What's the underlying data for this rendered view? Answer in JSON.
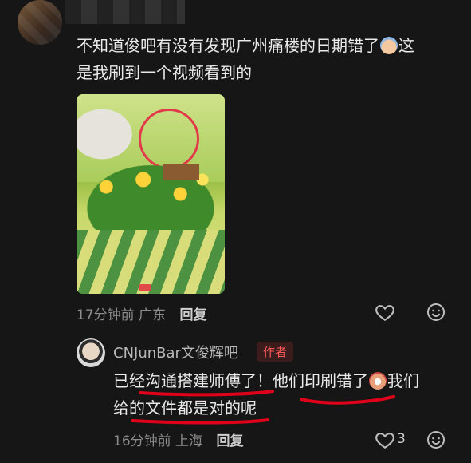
{
  "post": {
    "text_line1": "不知道俊吧有没有发现广州痛楼的日期错了",
    "text_line1_tail": "这",
    "text_line2": "是我刷到一个视频看到的",
    "emoji_name": "sweat-smile-emoji",
    "time": "17分钟前",
    "location": "广东",
    "reply_label": "回复"
  },
  "reply": {
    "author": "CNJunBar文俊辉吧",
    "badge": "作者",
    "text_part1": "已经沟通搭建师傅了！他们印刷错了",
    "text_part2": "我们",
    "text_line2": "给的文件都是对的呢",
    "emoji_name": "shocked-emoji",
    "time": "16分钟前",
    "location": "上海",
    "reply_label": "回复",
    "like_count": "3"
  },
  "colors": {
    "background": "#161616",
    "badge_text": "#ff5a5a",
    "annotation_red": "#e0001a"
  }
}
